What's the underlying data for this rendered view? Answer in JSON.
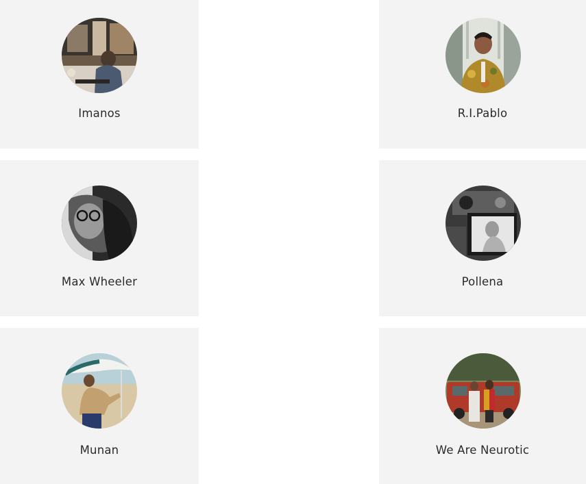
{
  "artists": [
    {
      "name": "Imanos",
      "photo": "person-sitting-at-cafe-table-photo"
    },
    {
      "name": "R.I.Pablo",
      "photo": "man-in-floral-shirt-photo"
    },
    {
      "name": "Max Wheeler",
      "photo": "man-with-glasses-black-and-white-photo"
    },
    {
      "name": "Pollena",
      "photo": "camera-screen-black-and-white-photo"
    },
    {
      "name": "Munan",
      "photo": "person-on-beach-with-umbrella-photo"
    },
    {
      "name": "We Are Neurotic",
      "photo": "two-people-by-red-van-photo"
    }
  ],
  "colors": {
    "card_background": "#f3f3f3",
    "page_background": "#ffffff",
    "name_text": "#2a2a2a"
  }
}
